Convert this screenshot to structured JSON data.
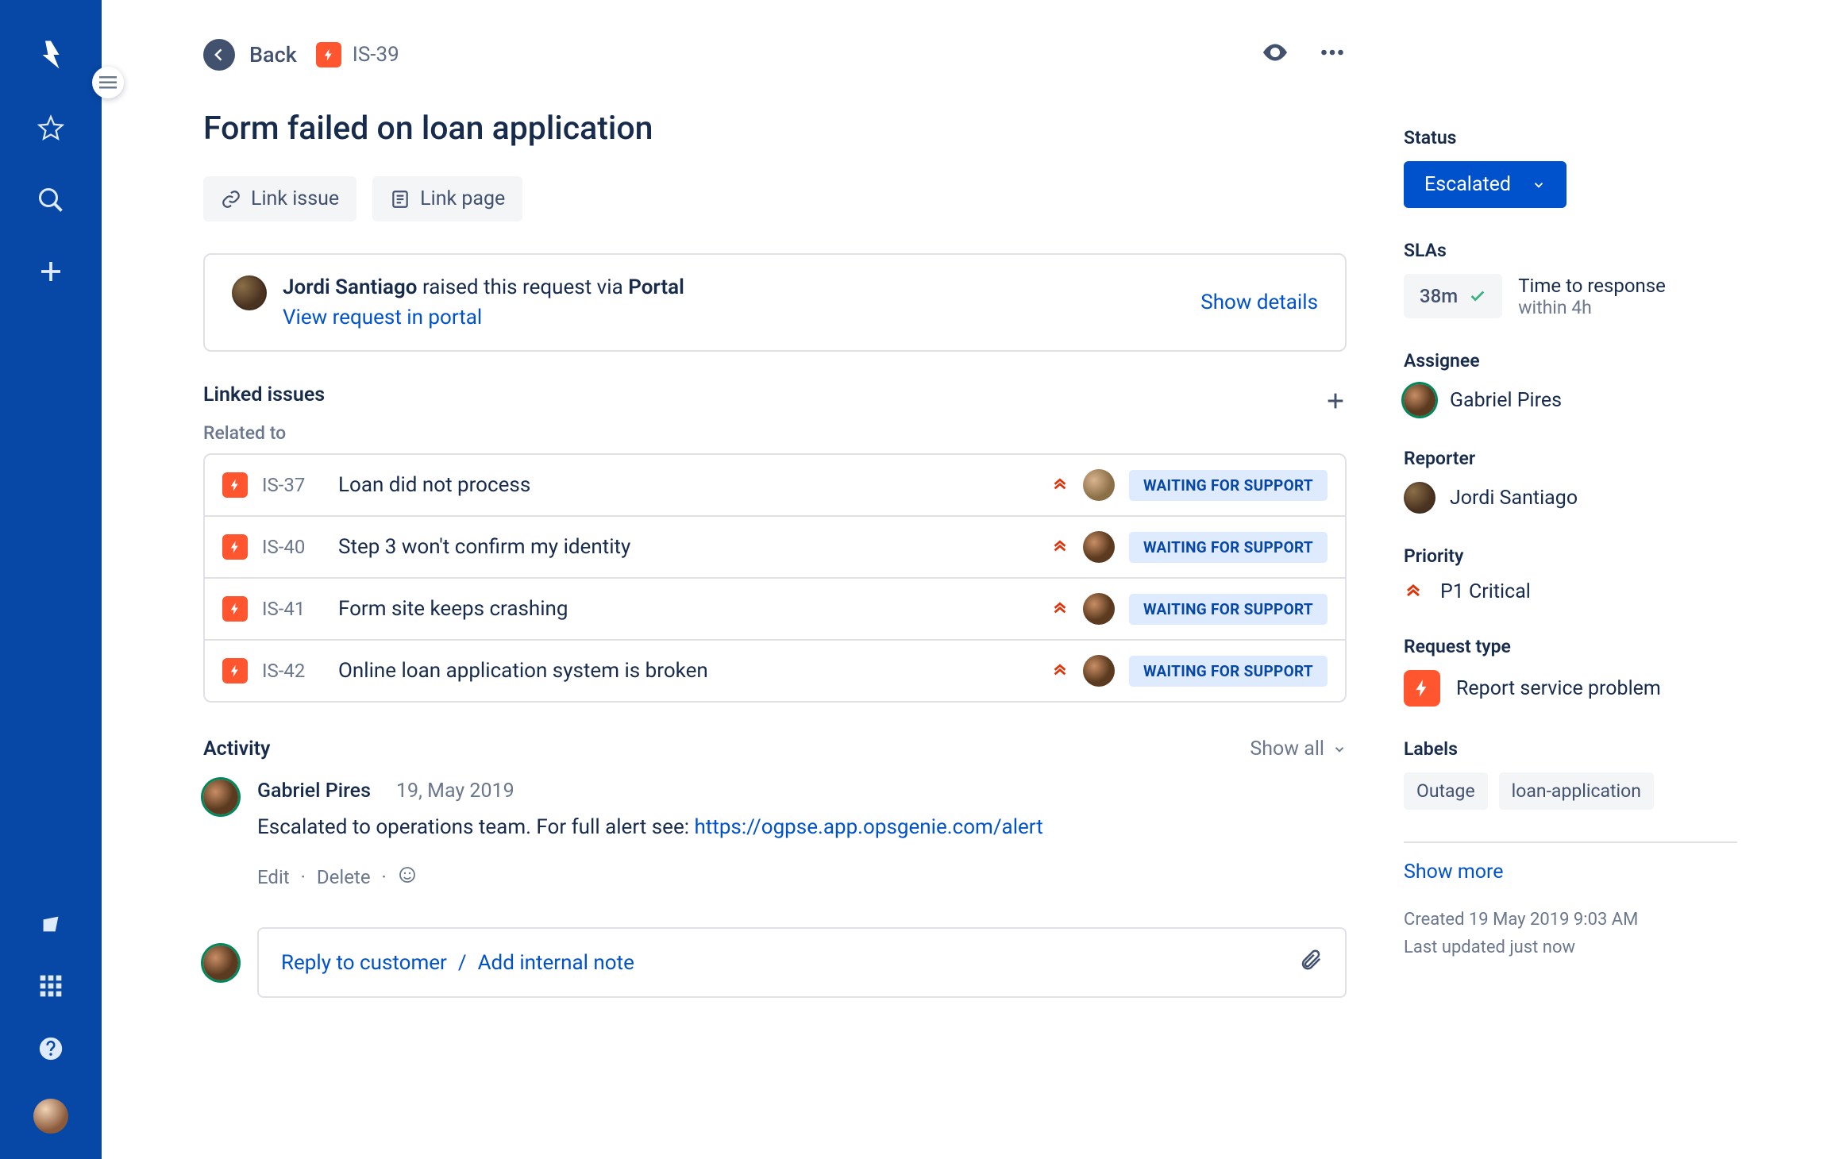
{
  "breadcrumb": {
    "back": "Back",
    "issue_key": "IS-39"
  },
  "title": "Form failed on loan application",
  "actions": {
    "link_issue": "Link issue",
    "link_page": "Link page"
  },
  "request": {
    "reporter_name": "Jordi Santiago",
    "raised_text": "raised this request via",
    "channel": "Portal",
    "view_link": "View request in portal",
    "show_details": "Show details"
  },
  "linked": {
    "heading": "Linked issues",
    "related": "Related to",
    "status_label": "WAITING FOR SUPPORT",
    "items": [
      {
        "key": "IS-37",
        "summary": "Loan did not process"
      },
      {
        "key": "IS-40",
        "summary": "Step 3 won't confirm my identity"
      },
      {
        "key": "IS-41",
        "summary": "Form site keeps crashing"
      },
      {
        "key": "IS-42",
        "summary": "Online loan application system is broken"
      }
    ]
  },
  "activity": {
    "heading": "Activity",
    "show_all": "Show all",
    "comment": {
      "author": "Gabriel Pires",
      "date": "19, May 2019",
      "text": "Escalated to operations team. For full alert see: ",
      "link": "https://ogpse.app.opsgenie.com/alert",
      "edit": "Edit",
      "delete": "Delete"
    },
    "reply": {
      "reply_customer": "Reply to customer",
      "sep": "/",
      "add_note": "Add internal note"
    }
  },
  "side": {
    "status_label": "Status",
    "status_value": "Escalated",
    "slas_label": "SLAs",
    "sla_time": "38m",
    "sla_title": "Time to response",
    "sla_sub": "within 4h",
    "assignee_label": "Assignee",
    "assignee": "Gabriel Pires",
    "reporter_label": "Reporter",
    "reporter": "Jordi Santiago",
    "priority_label": "Priority",
    "priority": "P1 Critical",
    "request_type_label": "Request type",
    "request_type": "Report service problem",
    "labels_label": "Labels",
    "labels": [
      "Outage",
      "loan-application"
    ],
    "show_more": "Show more",
    "created": "Created 19 May 2019 9:03 AM",
    "updated": "Last updated just now"
  }
}
